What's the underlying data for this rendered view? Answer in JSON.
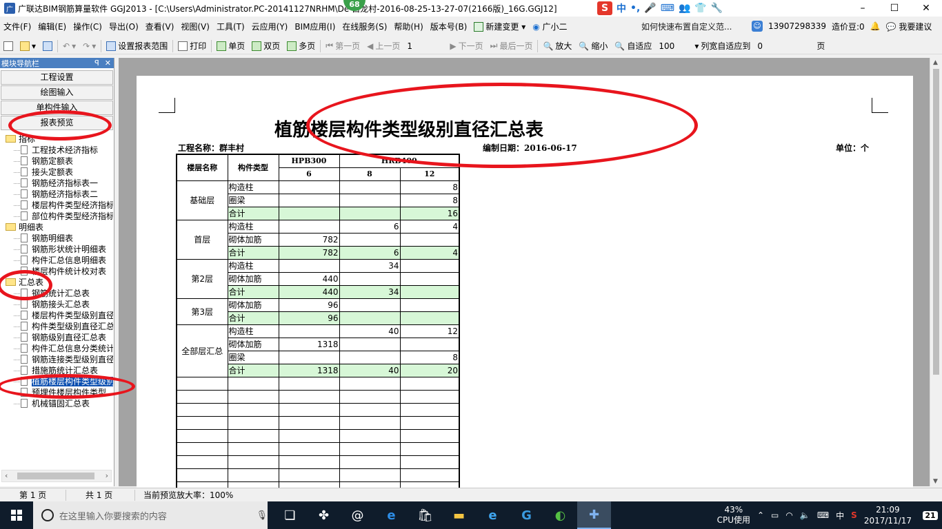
{
  "window": {
    "title": "广联达BIM钢筋算量软件 GGJ2013 - [C:\\Users\\Administrator.PC-20141127NRHM\\De",
    "title_tail": "白龙村-2016-08-25-13-27-07(2166版)_16G.GGJ12]",
    "badge": "68",
    "minimize": "–",
    "maximize": "☐",
    "close": "✕"
  },
  "ime": {
    "logo": "S",
    "mode": "中",
    "punct": "•,",
    "voice": "🎤",
    "keyboard": "⌨",
    "user": "👥",
    "skin": "👕",
    "tools": "🔧"
  },
  "menu": {
    "items": [
      "文件(F)",
      "编辑(E)",
      "操作(C)",
      "导出(O)",
      "查看(V)",
      "视图(V)",
      "工具(T)",
      "云应用(Y)",
      "BIM应用(I)",
      "在线服务(S)",
      "帮助(H)",
      "版本号(B)"
    ],
    "new_change": "新建变更 ▾",
    "assistant": "广小二",
    "help_link": "如何快速布置自定义范...",
    "phone": "13907298339",
    "beans": "造价豆:0",
    "suggest": "我要建议"
  },
  "toolbar": {
    "set_range": "设置报表范围",
    "print": "打印",
    "single": "单页",
    "double": "双页",
    "multi": "多页",
    "first": "第一页",
    "prev": "上一页",
    "page_value": "1",
    "next": "下一页",
    "last": "最后一页",
    "zoom_in": "放大",
    "zoom_out": "缩小",
    "fit": "自适应",
    "zoom_value": "100",
    "col_fit": "列宽自适应到",
    "col_value": "0",
    "page_unit": "页"
  },
  "nav": {
    "header": "模块导航栏",
    "pin": "ꟼ",
    "close": "✕",
    "buttons": [
      "工程设置",
      "绘图输入",
      "单构件输入",
      "报表预览"
    ],
    "tree": [
      {
        "type": "folder",
        "label": "指标"
      },
      {
        "type": "leaf",
        "label": "工程技术经济指标"
      },
      {
        "type": "leaf",
        "label": "钢筋定额表"
      },
      {
        "type": "leaf",
        "label": "接头定额表"
      },
      {
        "type": "leaf",
        "label": "钢筋经济指标表一"
      },
      {
        "type": "leaf",
        "label": "钢筋经济指标表二"
      },
      {
        "type": "leaf",
        "label": "楼层构件类型经济指标"
      },
      {
        "type": "leaf",
        "label": "部位构件类型经济指标"
      },
      {
        "type": "folder",
        "label": "明细表"
      },
      {
        "type": "leaf",
        "label": "钢筋明细表"
      },
      {
        "type": "leaf",
        "label": "钢筋形状统计明细表"
      },
      {
        "type": "leaf",
        "label": "构件汇总信息明细表"
      },
      {
        "type": "leaf",
        "label": "楼层构件统计校对表"
      },
      {
        "type": "folder",
        "label": "汇总表"
      },
      {
        "type": "leaf",
        "label": "钢筋统计汇总表"
      },
      {
        "type": "leaf",
        "label": "钢筋接头汇总表"
      },
      {
        "type": "leaf",
        "label": "楼层构件类型级别直径"
      },
      {
        "type": "leaf",
        "label": "构件类型级别直径汇总"
      },
      {
        "type": "leaf",
        "label": "钢筋级别直径汇总表"
      },
      {
        "type": "leaf",
        "label": "构件汇总信息分类统计"
      },
      {
        "type": "leaf",
        "label": "钢筋连接类型级别直径"
      },
      {
        "type": "leaf",
        "label": "措施筋统计汇总表"
      },
      {
        "type": "leaf",
        "label": "植筋楼层构件类型级别",
        "selected": true
      },
      {
        "type": "leaf",
        "label": "预埋件楼层构件类型"
      },
      {
        "type": "leaf",
        "label": "机械锚固汇总表"
      }
    ]
  },
  "report": {
    "title": "植筋楼层构件类型级别直径汇总表",
    "project_label": "工程名称：群丰村",
    "date_label": "编制日期：2016-06-17",
    "unit_label": "单位：个",
    "headers": {
      "floor": "楼层名称",
      "type": "构件类型",
      "grade1": "HPB300",
      "grade2": "HRB400",
      "d6": "6",
      "d8": "8",
      "d12": "12"
    },
    "rows": [
      {
        "floor": "基础层",
        "span": 3,
        "type": "构造柱",
        "d6": "",
        "d8": "",
        "d12": "8",
        "total": false
      },
      {
        "type": "圈梁",
        "d6": "",
        "d8": "",
        "d12": "8",
        "total": false
      },
      {
        "type": "合计",
        "d6": "",
        "d8": "",
        "d12": "16",
        "total": true
      },
      {
        "floor": "首层",
        "span": 3,
        "type": "构造柱",
        "d6": "",
        "d8": "6",
        "d12": "4",
        "total": false
      },
      {
        "type": "砌体加筋",
        "d6": "782",
        "d8": "",
        "d12": "",
        "total": false
      },
      {
        "type": "合计",
        "d6": "782",
        "d8": "6",
        "d12": "4",
        "total": true
      },
      {
        "floor": "第2层",
        "span": 3,
        "type": "构造柱",
        "d6": "",
        "d8": "34",
        "d12": "",
        "total": false
      },
      {
        "type": "砌体加筋",
        "d6": "440",
        "d8": "",
        "d12": "",
        "total": false
      },
      {
        "type": "合计",
        "d6": "440",
        "d8": "34",
        "d12": "",
        "total": true
      },
      {
        "floor": "第3层",
        "span": 2,
        "type": "砌体加筋",
        "d6": "96",
        "d8": "",
        "d12": "",
        "total": false
      },
      {
        "type": "合计",
        "d6": "96",
        "d8": "",
        "d12": "",
        "total": true
      },
      {
        "floor": "全部层汇总",
        "span": 4,
        "type": "构造柱",
        "d6": "",
        "d8": "40",
        "d12": "12",
        "total": false
      },
      {
        "type": "砌体加筋",
        "d6": "1318",
        "d8": "",
        "d12": "",
        "total": false
      },
      {
        "type": "圈梁",
        "d6": "",
        "d8": "",
        "d12": "8",
        "total": false
      },
      {
        "type": "合计",
        "d6": "1318",
        "d8": "40",
        "d12": "20",
        "total": true
      }
    ],
    "empty_rows": 9
  },
  "status": {
    "page": "第 1 页",
    "total": "共 1 页",
    "zoom": "当前预览放大率：100%"
  },
  "taskbar": {
    "search_placeholder": "在这里输入你要搜索的内容",
    "cpu_pct": "43%",
    "cpu_label": "CPU使用",
    "ime": "中",
    "time": "21:09",
    "date": "2017/11/17",
    "notif_count": "21"
  },
  "colors": {
    "total_row": "#d7f7d7",
    "annotation": "#e8151d",
    "nav_header": "#4a7fc1"
  }
}
